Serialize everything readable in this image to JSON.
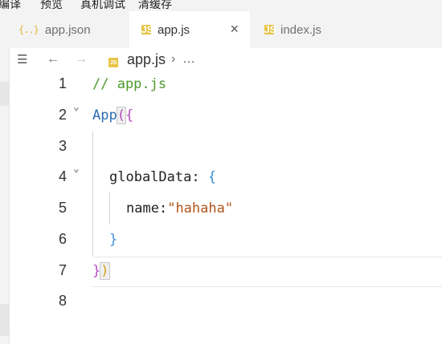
{
  "toolbar": {
    "items": [
      "编译",
      "预览",
      "真机调试",
      "清缓存"
    ]
  },
  "tabs": [
    {
      "label": "app.json",
      "icon": "json-file-icon",
      "icon_text": "{..}"
    },
    {
      "label": "app.js",
      "icon": "js-file-icon",
      "icon_text": "JS",
      "active": true,
      "close": "×"
    },
    {
      "label": "index.js",
      "icon": "js-file-icon",
      "icon_text": "JS"
    }
  ],
  "breadcrumb": {
    "list_icon": "☰",
    "back_icon": "←",
    "forward_icon": "→",
    "file_icon_text": "JS",
    "file": "app.js",
    "separator": "›",
    "more": "…"
  },
  "editor": {
    "line_numbers": [
      "1",
      "2",
      "3",
      "4",
      "5",
      "6",
      "7",
      "8"
    ],
    "lines": {
      "l1_comment": "// app.js",
      "l2_fn": "App",
      "l2_paren": "(",
      "l2_brace": "{",
      "l4_key": "globalData",
      "l4_colon": ": ",
      "l4_brace": "{",
      "l5_key": "name",
      "l5_colon": ":",
      "l5_value": "\"hahaha\"",
      "l6_brace": "}",
      "l7_brace": "}",
      "l7_paren": ")"
    },
    "fold_glyph": "⌄"
  }
}
